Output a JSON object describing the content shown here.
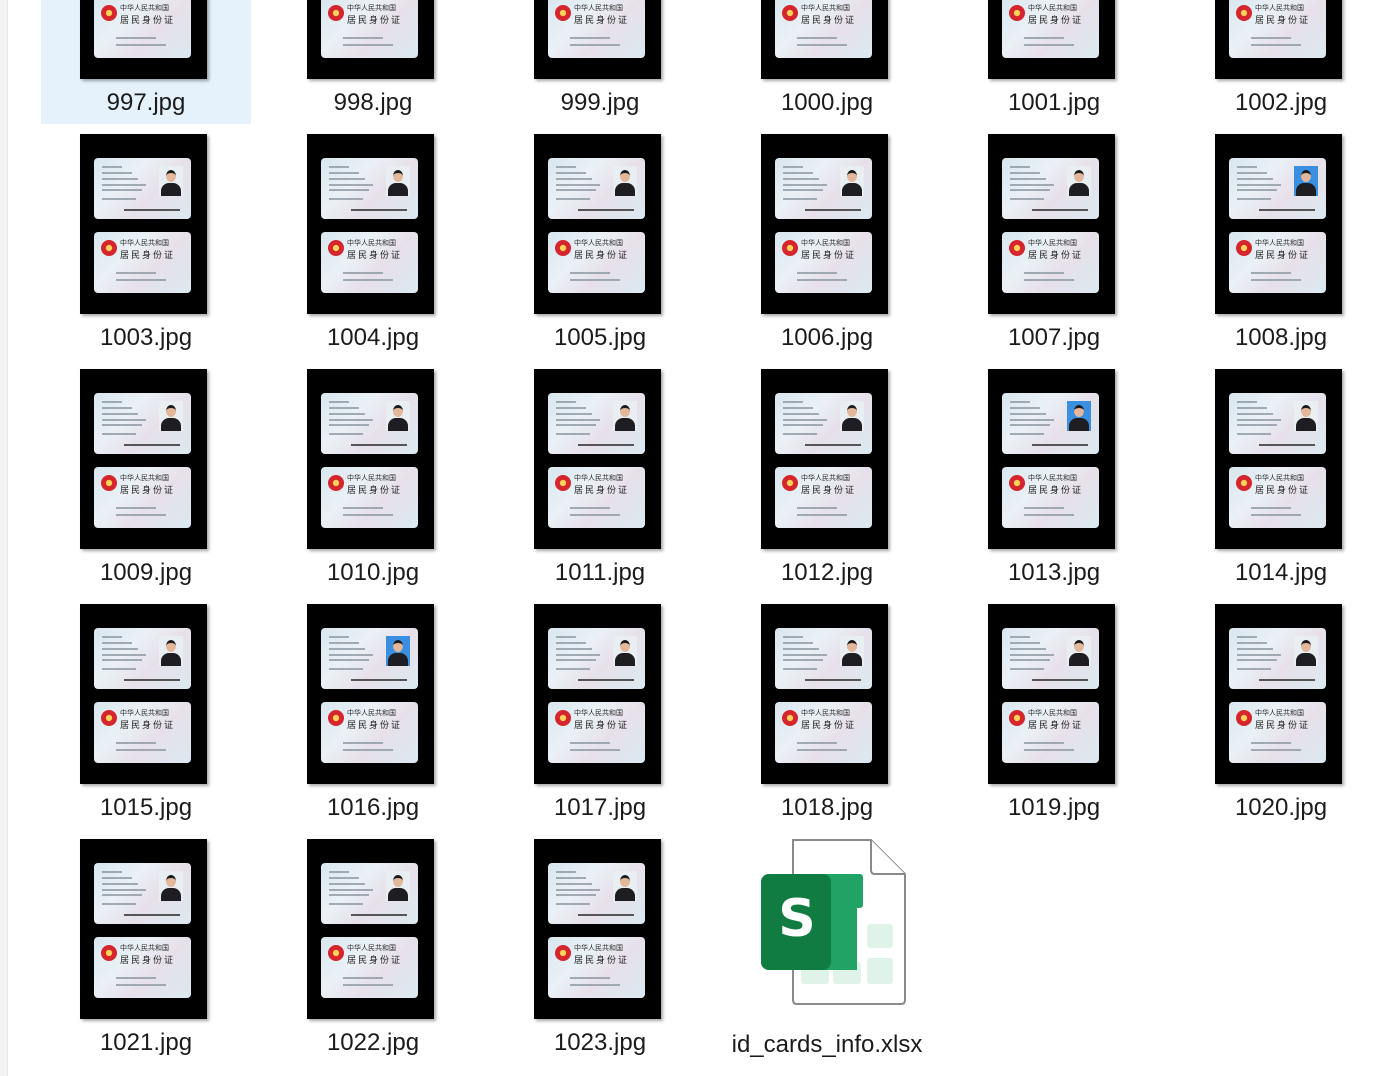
{
  "files": [
    {
      "name": "997.jpg",
      "selected": true,
      "blue": false
    },
    {
      "name": "998.jpg",
      "blue": false
    },
    {
      "name": "999.jpg",
      "blue": false
    },
    {
      "name": "1000.jpg",
      "blue": false
    },
    {
      "name": "1001.jpg",
      "blue": false
    },
    {
      "name": "1002.jpg",
      "blue": false
    },
    {
      "name": "1003.jpg",
      "blue": false
    },
    {
      "name": "1004.jpg",
      "blue": false
    },
    {
      "name": "1005.jpg",
      "blue": false
    },
    {
      "name": "1006.jpg",
      "blue": false
    },
    {
      "name": "1007.jpg",
      "blue": false
    },
    {
      "name": "1008.jpg",
      "blue": true
    },
    {
      "name": "1009.jpg",
      "blue": false
    },
    {
      "name": "1010.jpg",
      "blue": false
    },
    {
      "name": "1011.jpg",
      "blue": false
    },
    {
      "name": "1012.jpg",
      "blue": false
    },
    {
      "name": "1013.jpg",
      "blue": true
    },
    {
      "name": "1014.jpg",
      "blue": false
    },
    {
      "name": "1015.jpg",
      "blue": false
    },
    {
      "name": "1016.jpg",
      "blue": true
    },
    {
      "name": "1017.jpg",
      "blue": false
    },
    {
      "name": "1018.jpg",
      "blue": false
    },
    {
      "name": "1019.jpg",
      "blue": false
    },
    {
      "name": "1020.jpg",
      "blue": false
    },
    {
      "name": "1021.jpg",
      "blue": false
    },
    {
      "name": "1022.jpg",
      "blue": false
    },
    {
      "name": "1023.jpg",
      "blue": false
    }
  ],
  "spreadsheet": {
    "name": "id_cards_info.xlsx",
    "icon": "spreadsheet-file-icon",
    "icon_letter": "S",
    "accent": "#107c41"
  },
  "card_text": {
    "title": "中华人民共和国",
    "subtitle": "居民身份证"
  },
  "colors": {
    "selection": "#e5f1fb",
    "thumb_bg": "#000000"
  }
}
